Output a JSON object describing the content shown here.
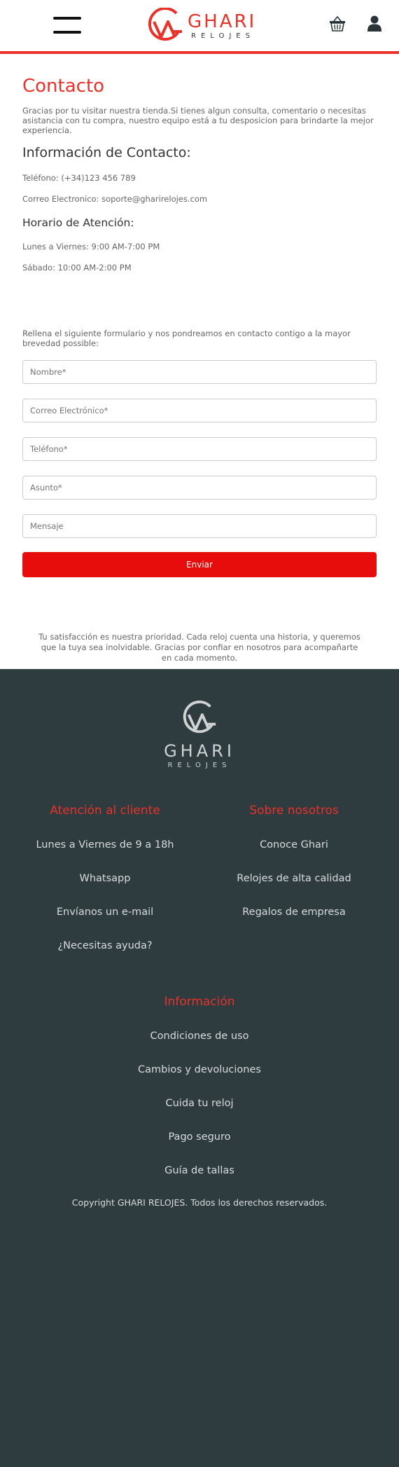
{
  "header": {
    "brand_name": "GHARI",
    "brand_sub": "RELOJES",
    "icons": [
      "menu-icon",
      "basket-icon",
      "user-icon"
    ],
    "accent_color": "#e8322a"
  },
  "contact": {
    "title": "Contacto",
    "intro": "Gracias por tu visitar nuestra tienda.Si tienes algun consulta, comentario o necesitas asistancia con tu compra, nuestro equipo está a tu desposicion para brindarte la mejor experiencia.",
    "info_heading": "Información de Contacto:",
    "phone": "Teléfono: (+34)123 456 789",
    "email": "Correo Electronico: soporte@gharirelojes.com",
    "hours_heading": "Horario de Atención:",
    "hours_weekdays": "Lunes a Viernes: 9:00 AM-7:00 PM",
    "hours_saturday": "Sábado: 10:00 AM-2:00 PM"
  },
  "form": {
    "intro": "Rellena el siguiente formulario y nos pondreamos en contacto contigo a la mayor brevedad possible:",
    "name_placeholder": "Nombre*",
    "email_placeholder": "Correo Electrónico*",
    "phone_placeholder": "Teléfono*",
    "subject_placeholder": "Asunto*",
    "message_placeholder": "Mensaje",
    "submit_label": "Enviar",
    "submit_color": "#e80d0d"
  },
  "tagline": "Tu satisfacción es nuestra prioridad. Cada reloj cuenta una historia, y queremos que la tuya sea inolvidable. Gracias por confiar en nosotros para acompañarte en cada momento.",
  "footer": {
    "brand_name": "GHARI",
    "brand_sub": "RELOJES",
    "customer_service": {
      "heading": "Atención al cliente",
      "links": [
        "Lunes a Viernes de 9 a 18h",
        "Whatsapp",
        "Envíanos un e-mail",
        "¿Necesitas ayuda?"
      ]
    },
    "about": {
      "heading": "Sobre nosotros",
      "links": [
        "Conoce Ghari",
        "Relojes de alta calidad",
        "Regalos de empresa"
      ]
    },
    "info": {
      "heading": "Información",
      "links": [
        "Condiciones de uso",
        "Cambios y devoluciones",
        "Cuida tu reloj",
        "Pago seguro",
        "Guía de tallas"
      ]
    },
    "copyright": "Copyright GHARI RELOJES. Todos los derechos reservados.",
    "background_color": "#2e3b3f"
  }
}
